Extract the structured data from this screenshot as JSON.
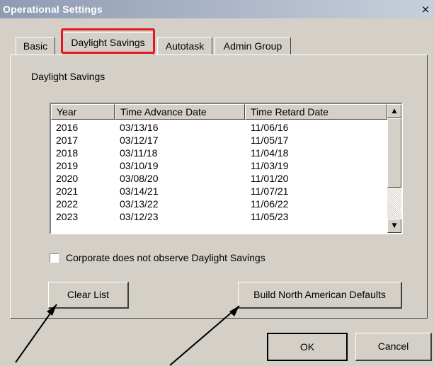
{
  "window": {
    "title": "Operational Settings",
    "close_glyph": "×"
  },
  "tabs": [
    {
      "label": "Basic",
      "active": false
    },
    {
      "label": "Daylight Savings",
      "active": true
    },
    {
      "label": "Autotask",
      "active": false
    },
    {
      "label": "Admin Group",
      "active": false
    }
  ],
  "section": {
    "label": "Daylight Savings"
  },
  "list": {
    "columns": [
      "Year",
      "Time Advance Date",
      "Time Retard Date"
    ],
    "rows": [
      [
        "2016",
        "03/13/16",
        "11/06/16"
      ],
      [
        "2017",
        "03/12/17",
        "11/05/17"
      ],
      [
        "2018",
        "03/11/18",
        "11/04/18"
      ],
      [
        "2019",
        "03/10/19",
        "11/03/19"
      ],
      [
        "2020",
        "03/08/20",
        "11/01/20"
      ],
      [
        "2021",
        "03/14/21",
        "11/07/21"
      ],
      [
        "2022",
        "03/13/22",
        "11/06/22"
      ],
      [
        "2023",
        "03/12/23",
        "11/05/23"
      ]
    ],
    "scroll_up_glyph": "▲",
    "scroll_down_glyph": "▼"
  },
  "checkbox": {
    "label": "Corporate does not observe Daylight Savings",
    "checked": false
  },
  "buttons": {
    "clear_list": "Clear List",
    "build_defaults": "Build North American Defaults",
    "ok": "OK",
    "cancel": "Cancel"
  },
  "colors": {
    "highlight": "#e8151e",
    "dialog_bg": "#d4d0c8",
    "title_gradient_start": "#8e9bb2"
  }
}
